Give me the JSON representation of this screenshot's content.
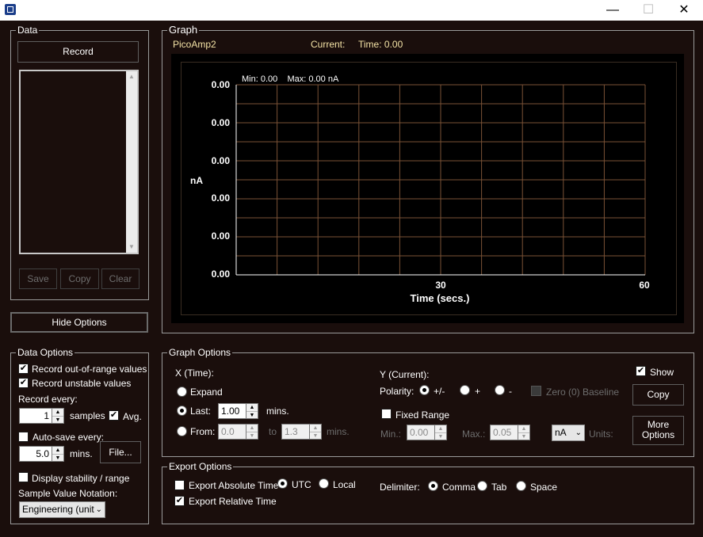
{
  "window": {
    "minimize_glyph": "—",
    "maximize_glyph": "☐",
    "close_glyph": "✕",
    "app_icon": "app-icon"
  },
  "data_panel": {
    "legend": "Data",
    "record_label": "Record",
    "save_label": "Save",
    "copy_label": "Copy",
    "clear_label": "Clear",
    "hide_options_label": "Hide Options"
  },
  "graph_panel": {
    "legend": "Graph",
    "device": "PicoAmp2",
    "current_label": "Current:",
    "time_label": "Time: 0.00",
    "min_max": "Min: 0.00    Max: 0.00 nA",
    "y_ticks": [
      "0.00",
      "0.00",
      "0.00",
      "0.00",
      "0.00",
      "0.00"
    ],
    "y_unit": "nA",
    "x_ticks": [
      "30",
      "60"
    ],
    "x_label": "Time (secs.)"
  },
  "chart_data": {
    "type": "line",
    "x": [],
    "series": [],
    "xlabel": "Time (secs.)",
    "ylabel": "nA",
    "xlim": [
      0,
      60
    ],
    "grid": true
  },
  "data_options": {
    "legend": "Data Options",
    "out_of_range_label": "Record out-of-range values",
    "out_of_range_checked": true,
    "unstable_label": "Record unstable values",
    "unstable_checked": true,
    "record_every_label": "Record every:",
    "record_every_value": "1",
    "samples_label": "samples",
    "avg_label": "Avg.",
    "avg_checked": true,
    "autosave_label": "Auto-save every:",
    "autosave_checked": false,
    "autosave_value": "5.0",
    "mins_label": "mins.",
    "file_label": "File...",
    "stability_label": "Display stability / range",
    "stability_checked": false,
    "notation_label": "Sample Value Notation:",
    "notation_value": "Engineering (units"
  },
  "graph_options": {
    "legend": "Graph Options",
    "x_header": "X (Time):",
    "expand_label": "Expand",
    "last_label": "Last:",
    "last_value": "1.00",
    "last_mins": "mins.",
    "from_label": "From:",
    "from_value": "0.0",
    "to_label": "to",
    "to_value": "1.3",
    "from_mins": "mins.",
    "x_mode": "last",
    "y_header": "Y (Current):",
    "polarity_label": "Polarity:",
    "polarity_options": [
      "+/-",
      "+",
      "-"
    ],
    "polarity_selected": "+/-",
    "zero_baseline_label": "Zero (0) Baseline",
    "fixed_range_label": "Fixed Range",
    "fixed_range_checked": false,
    "min_label": "Min.:",
    "min_value": "0.00",
    "max_label": "Max.:",
    "max_value": "0.05",
    "units_value": "nA",
    "units_label": "Units:",
    "show_label": "Show",
    "show_checked": true,
    "copy_label": "Copy",
    "more_options_line1": "More",
    "more_options_line2": "Options"
  },
  "export_options": {
    "legend": "Export Options",
    "absolute_label": "Export Absolute Time",
    "absolute_checked": false,
    "utc_label": "UTC",
    "local_label": "Local",
    "time_zone": "UTC",
    "relative_label": "Export Relative Time",
    "relative_checked": true,
    "delimiter_label": "Delimiter:",
    "delimiters": [
      "Comma",
      "Tab",
      "Space"
    ],
    "delimiter_selected": "Comma"
  }
}
